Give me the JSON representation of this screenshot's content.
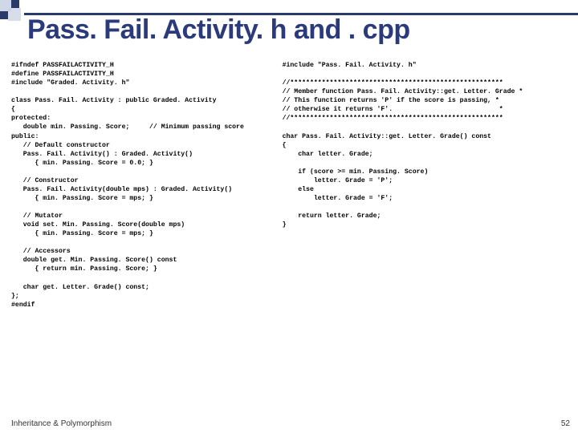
{
  "title": "Pass. Fail. Activity. h and . cpp",
  "footer": "Inheritance & Polymorphism",
  "slidenum": "52",
  "code_left": "#ifndef PASSFAILACTIVITY_H\n#define PASSFAILACTIVITY_H\n#include \"Graded. Activity. h\"\n\nclass Pass. Fail. Activity : public Graded. Activity\n{\nprotected:\n   double min. Passing. Score;     // Minimum passing score\npublic:\n   // Default constructor\n   Pass. Fail. Activity() : Graded. Activity()\n      { min. Passing. Score = 0.0; }\n\n   // Constructor\n   Pass. Fail. Activity(double mps) : Graded. Activity()\n      { min. Passing. Score = mps; }\n\n   // Mutator\n   void set. Min. Passing. Score(double mps)\n      { min. Passing. Score = mps; }\n\n   // Accessors\n   double get. Min. Passing. Score() const\n      { return min. Passing. Score; }\n\n   char get. Letter. Grade() const;\n};\n#endif",
  "code_right": "#include \"Pass. Fail. Activity. h\"\n\n//******************************************************\n// Member function Pass. Fail. Activity::get. Letter. Grade *\n// This function returns 'P' if the score is passing, *\n// otherwise it returns 'F'.                           *\n//******************************************************\n\nchar Pass. Fail. Activity::get. Letter. Grade() const\n{\n    char letter. Grade;\n\n    if (score >= min. Passing. Score)\n        letter. Grade = 'P';\n    else\n        letter. Grade = 'F';\n\n    return letter. Grade;\n}"
}
